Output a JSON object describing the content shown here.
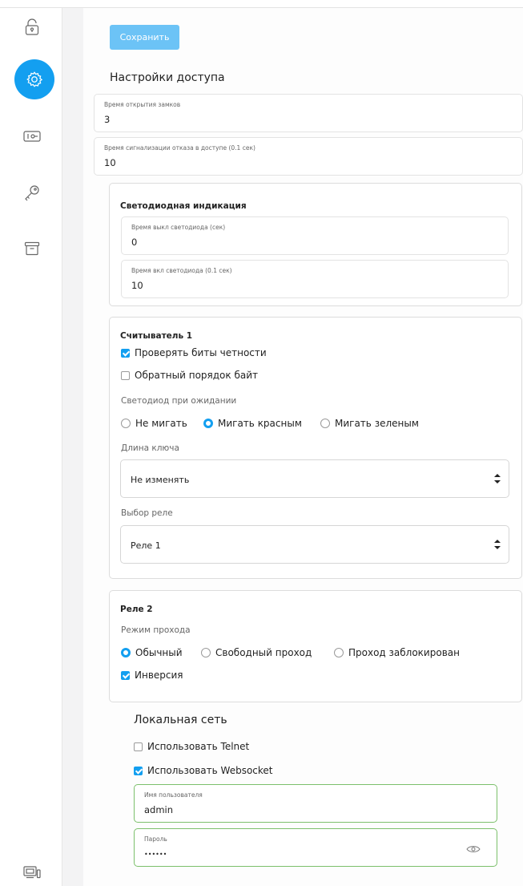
{
  "toolbar": {
    "save_label": "Сохранить"
  },
  "sidebar": {
    "items": [
      {
        "icon": "lock-icon",
        "active": false
      },
      {
        "icon": "gear-icon",
        "active": true
      },
      {
        "icon": "key-card-icon",
        "active": false
      },
      {
        "icon": "key-icon",
        "active": false
      },
      {
        "icon": "archive-icon",
        "active": false
      },
      {
        "icon": "devices-icon",
        "active": false
      }
    ]
  },
  "colors": {
    "accent": "#139ff0",
    "save_button": "#6cc3f6",
    "valid_border": "#7cc06b"
  },
  "access": {
    "title": "Настройки доступа",
    "lock_open_time": {
      "label": "Время открытия замков",
      "value": "3"
    },
    "denial_alarm_time": {
      "label": "Время сигнализации отказа в доступе (0.1 сек)",
      "value": "10"
    }
  },
  "led": {
    "title": "Светодиодная индикация",
    "off_time": {
      "label": "Время выкл светодиода (сек)",
      "value": "0"
    },
    "on_time": {
      "label": "Время вкл светодиода (0.1 сек)",
      "value": "10"
    }
  },
  "reader1": {
    "title": "Считыватель 1",
    "check_parity": {
      "label": "Проверять биты четности",
      "checked": true
    },
    "reverse_bytes": {
      "label": "Обратный порядок байт",
      "checked": false
    },
    "led_idle_label": "Светодиод при ожидании",
    "led_options": [
      {
        "label": "Не мигать",
        "checked": false
      },
      {
        "label": "Мигать красным",
        "checked": true
      },
      {
        "label": "Мигать зеленым",
        "checked": false
      }
    ],
    "key_length_label": "Длина ключа",
    "key_length_value": "Не изменять",
    "relay_label": "Выбор реле",
    "relay_value": "Реле 1"
  },
  "relay2": {
    "title": "Реле 2",
    "mode_label": "Режим прохода",
    "modes": [
      {
        "label": "Обычный",
        "checked": true
      },
      {
        "label": "Свободный проход",
        "checked": false
      },
      {
        "label": "Проход заблокирован",
        "checked": false
      }
    ],
    "inversion": {
      "label": "Инверсия",
      "checked": true
    }
  },
  "network": {
    "title": "Локальная сеть",
    "telnet": {
      "label": "Использовать Telnet",
      "checked": false
    },
    "websocket": {
      "label": "Использовать Websocket",
      "checked": true
    },
    "username": {
      "label": "Имя пользователя",
      "value": "admin"
    },
    "password": {
      "label": "Пароль",
      "value": "••••••"
    }
  }
}
